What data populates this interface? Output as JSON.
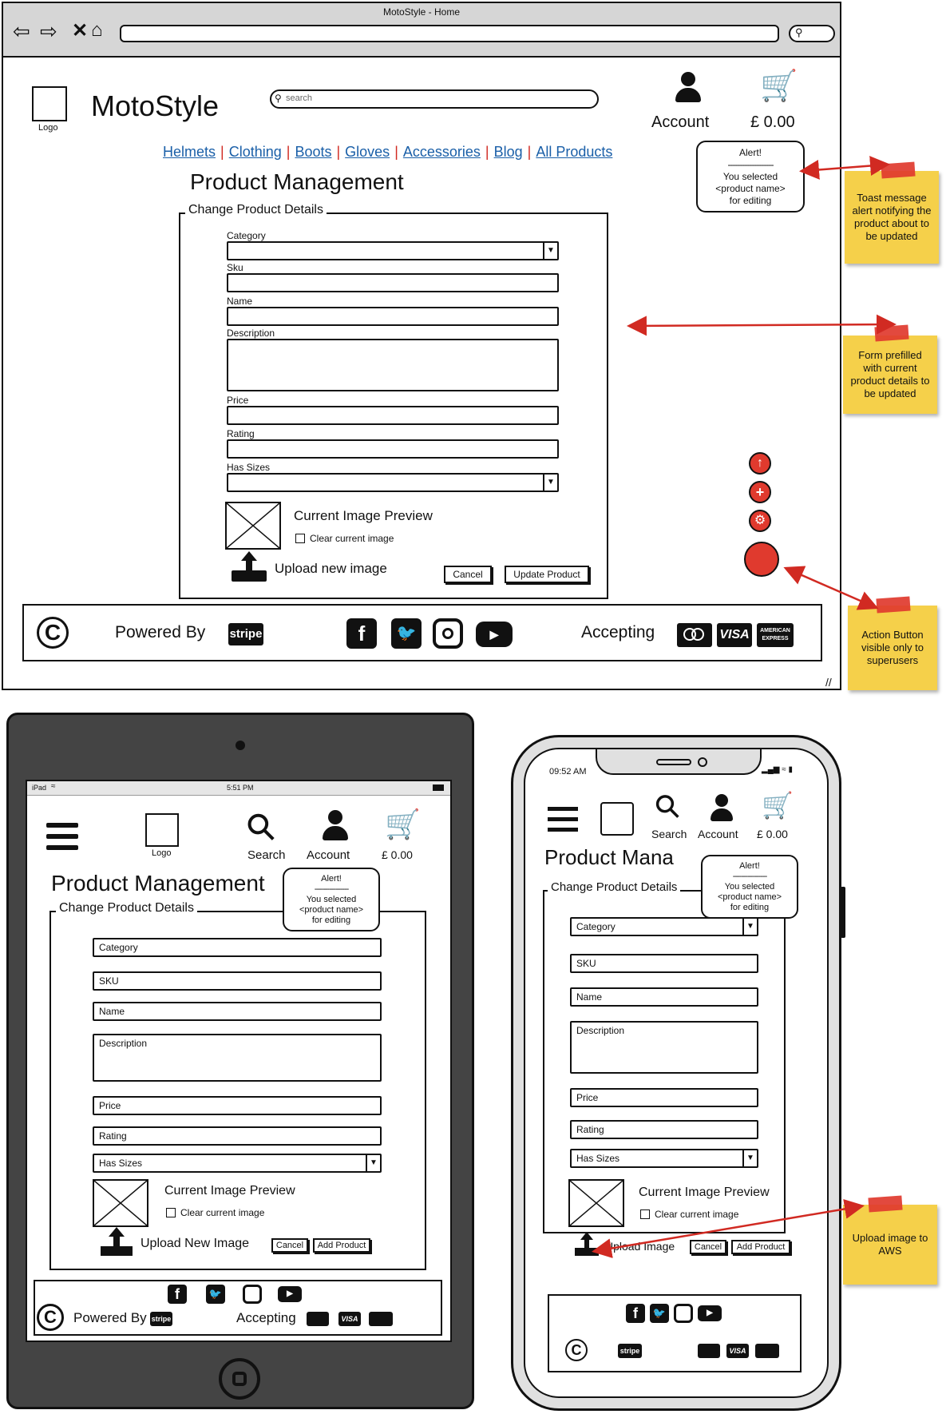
{
  "browser": {
    "title": "MotoStyle - Home"
  },
  "desktop": {
    "logo_label": "Logo",
    "brand": "MotoStyle",
    "search_placeholder": "search",
    "account_label": "Account",
    "cart_total": "£ 0.00",
    "nav": [
      "Helmets",
      "Clothing",
      "Boots",
      "Gloves",
      "Accessories",
      "Blog",
      "All Products"
    ],
    "page_title": "Product Management",
    "form_legend": "Change Product Details",
    "labels": {
      "category": "Category",
      "sku": "Sku",
      "name": "Name",
      "description": "Description",
      "price": "Price",
      "rating": "Rating",
      "has_sizes": "Has Sizes"
    },
    "current_image": "Current Image Preview",
    "clear_image": "Clear current image",
    "upload": "Upload new image",
    "cancel": "Cancel",
    "submit": "Update Product",
    "toast": {
      "title": "Alert!",
      "line1": "You selected",
      "line2": "<product name>",
      "line3": "for editing"
    },
    "footer": {
      "powered_by": "Powered By",
      "stripe": "stripe",
      "accepting": "Accepting",
      "visa": "VISA",
      "amex": "AMERICAN EXPRESS"
    }
  },
  "notes": {
    "toast": "Toast message alert notifying the product about to be updated",
    "form": "Form prefilled with current product details to be updated",
    "action": "Action Button visible only to superusers",
    "upload": "Upload image to AWS"
  },
  "tablet": {
    "status_left": "iPad",
    "status_time": "5:51 PM",
    "logo_label": "Logo",
    "search_label": "Search",
    "account_label": "Account",
    "cart_total": "£ 0.00",
    "page_title": "Product Management",
    "form_legend": "Change Product Details",
    "fields": {
      "category": "Category",
      "sku": "SKU",
      "name": "Name",
      "description": "Description",
      "price": "Price",
      "rating": "Rating",
      "has_sizes": "Has Sizes"
    },
    "current_image": "Current Image Preview",
    "clear_image": "Clear current image",
    "upload": "Upload New Image",
    "cancel": "Cancel",
    "submit": "Add Product",
    "toast": {
      "title": "Alert!",
      "line1": "You selected",
      "line2": "<product name>",
      "line3": "for editing"
    },
    "footer": {
      "powered_by": "Powered By",
      "stripe": "stripe",
      "accepting": "Accepting",
      "visa": "VISA"
    }
  },
  "phone": {
    "status_time": "09:52 AM",
    "search_label": "Search",
    "account_label": "Account",
    "cart_total": "£ 0.00",
    "page_title": "Product Mana",
    "form_legend": "Change Product Details",
    "fields": {
      "category": "Category",
      "sku": "SKU",
      "name": "Name",
      "description": "Description",
      "price": "Price",
      "rating": "Rating",
      "has_sizes": "Has Sizes"
    },
    "current_image": "Current Image Preview",
    "clear_image": "Clear current image",
    "upload": "Upload Image",
    "cancel": "Cancel",
    "submit": "Add Product",
    "toast": {
      "title": "Alert!",
      "line1": "You selected",
      "line2": "<product name>",
      "line3": "for editing"
    },
    "footer": {
      "stripe": "stripe",
      "visa": "VISA"
    }
  },
  "colors": {
    "link": "#1a5fa8",
    "action_red": "#e03a2e",
    "sticky": "#f5d04a",
    "chrome_gray": "#d6d6d6",
    "tablet_body": "#444444"
  }
}
